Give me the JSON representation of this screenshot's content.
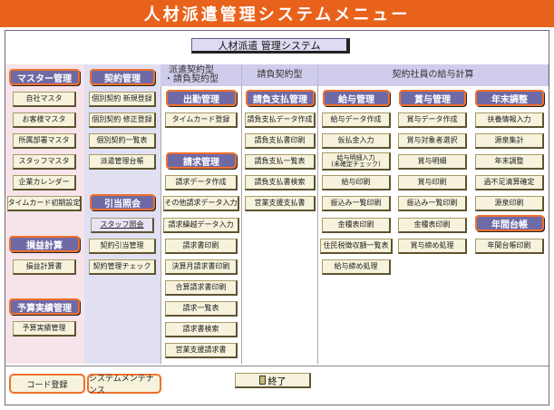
{
  "title_bar": "人材派遣管理システムメニュー",
  "system_title": "人材派遣 管理システム",
  "headers": {
    "dispatch": "派遣契約型\n・請負契約型",
    "subcontract": "請負契約型",
    "salary": "契約社員の給与計算"
  },
  "master": {
    "title": "マスター管理",
    "items": [
      "自社マスタ",
      "お客様マスタ",
      "所属部署マスタ",
      "スタッフマスタ",
      "企業カレンダー",
      "タイムカード初期設定"
    ],
    "profit_title": "損益計算",
    "profit_items": [
      "損益計算書"
    ],
    "budget_title": "予算実績管理",
    "budget_items": [
      "予算実績管理"
    ]
  },
  "contract": {
    "title": "契約管理",
    "items": [
      "個別契約 新規登録",
      "個別契約 修正登録",
      "個別契約一覧表",
      "派遣管理台帳"
    ],
    "lookup_title": "引当照会",
    "lookup_items": [
      "スタッフ照会",
      "契約引当管理",
      "契約管理チェック"
    ]
  },
  "dispatch": {
    "attendance_title": "出勤管理",
    "attendance_items": [
      "タイムカード登録"
    ],
    "billing_title": "請求管理",
    "billing_items": [
      "請求データ作成",
      "その他請求データ入力",
      "請求繰越データ入力",
      "請求書印刷",
      "決算月請求書印刷",
      "合算請求書印刷",
      "請求一覧表",
      "請求書検索",
      "営業支援請求書"
    ]
  },
  "subcontract": {
    "title": "請負支払管理",
    "items": [
      "請負支払データ作成",
      "請負支払書印刷",
      "請負支払一覧表",
      "請負支払書検索",
      "営業支援支払書"
    ]
  },
  "salary": {
    "title": "給与管理",
    "items": [
      "給与データ作成",
      "仮払金入力",
      "給与明細入力\n(未確定チェック)",
      "給与印刷",
      "振込み一覧印刷",
      "金種表印刷",
      "住民税徴収額一覧表",
      "給与締め処理"
    ]
  },
  "bonus": {
    "title": "賞与管理",
    "items": [
      "賞与データ作成",
      "賞与対象者選択",
      "賞与明細",
      "賞与印刷",
      "振込み一覧印刷",
      "金種表印刷",
      "賞与締め処理"
    ]
  },
  "yearend": {
    "title": "年末調整",
    "items": [
      "扶養情報入力",
      "源泉集計",
      "年末調整",
      "過不足清算確定",
      "源泉印刷"
    ],
    "ledger_title": "年間台帳",
    "ledger_items": [
      "年間台帳印刷"
    ]
  },
  "footer": {
    "code_register": "コード登録",
    "maintenance": "システムメンテナンス",
    "exit": "終了"
  },
  "colors": {
    "accent_orange": "#e9621c",
    "category_purple": "#6f6aa6",
    "button_cream": "#f6f2dc",
    "column_pink": "#f7e4ea",
    "column_lavender": "#e1e0f3"
  }
}
